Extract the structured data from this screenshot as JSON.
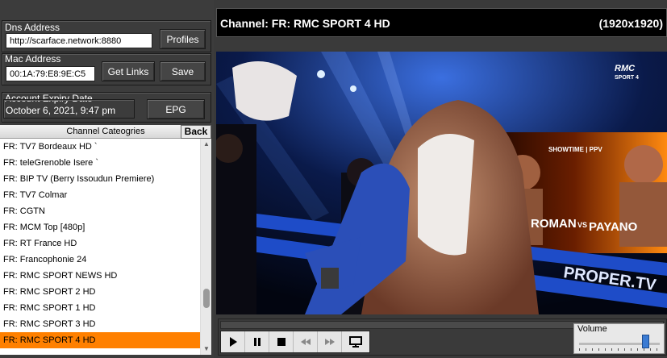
{
  "account": {
    "dns_label": "Dns Address",
    "dns_value": "http://scarface.network:8880",
    "profiles_label": "Profiles",
    "mac_label": "Mac Address",
    "mac_value": "00:1A:79:E8:9E:C5",
    "get_links_label": "Get Links",
    "save_label": "Save",
    "expiry_label": "Account Expiry Date",
    "expiry_value": "October 6, 2021, 9:47 pm",
    "epg_label": "EPG"
  },
  "categories": {
    "title": "Channel Cateogries",
    "back_label": "Back",
    "items": [
      "FR: TV7 Bordeaux HD `",
      "FR: teleGrenoble Isere `",
      "FR: BIP TV (Berry Issoudun Premiere)",
      "FR: TV7 Colmar",
      "FR: CGTN",
      "FR: MCM Top [480p]",
      "FR: RT France HD",
      "FR: Francophonie 24",
      "FR: RMC SPORT NEWS HD",
      "FR: RMC SPORT 2 HD",
      "FR: RMC SPORT 1 HD",
      "FR: RMC SPORT 3 HD",
      "FR: RMC SPORT 4 HD"
    ],
    "selected_index": 12,
    "selected_color": "#ff8000"
  },
  "player": {
    "channel": "Channel: FR: RMC SPORT 4 HD",
    "resolution": "(1920x1920)",
    "volume_label": "Volume",
    "volume": 0.82,
    "overlay": {
      "brand": "RMC",
      "brand_sub": "SPORT 4",
      "ppv": "SHOWTIME | PPV",
      "fighter1": "ROMAN",
      "vs": "VS",
      "fighter2": "PAYANO",
      "ring_text": "PROPER.TV"
    },
    "controls": [
      "play-icon",
      "pause-icon",
      "stop-icon",
      "rewind-icon",
      "fast-forward-icon",
      "monitor-icon"
    ]
  }
}
